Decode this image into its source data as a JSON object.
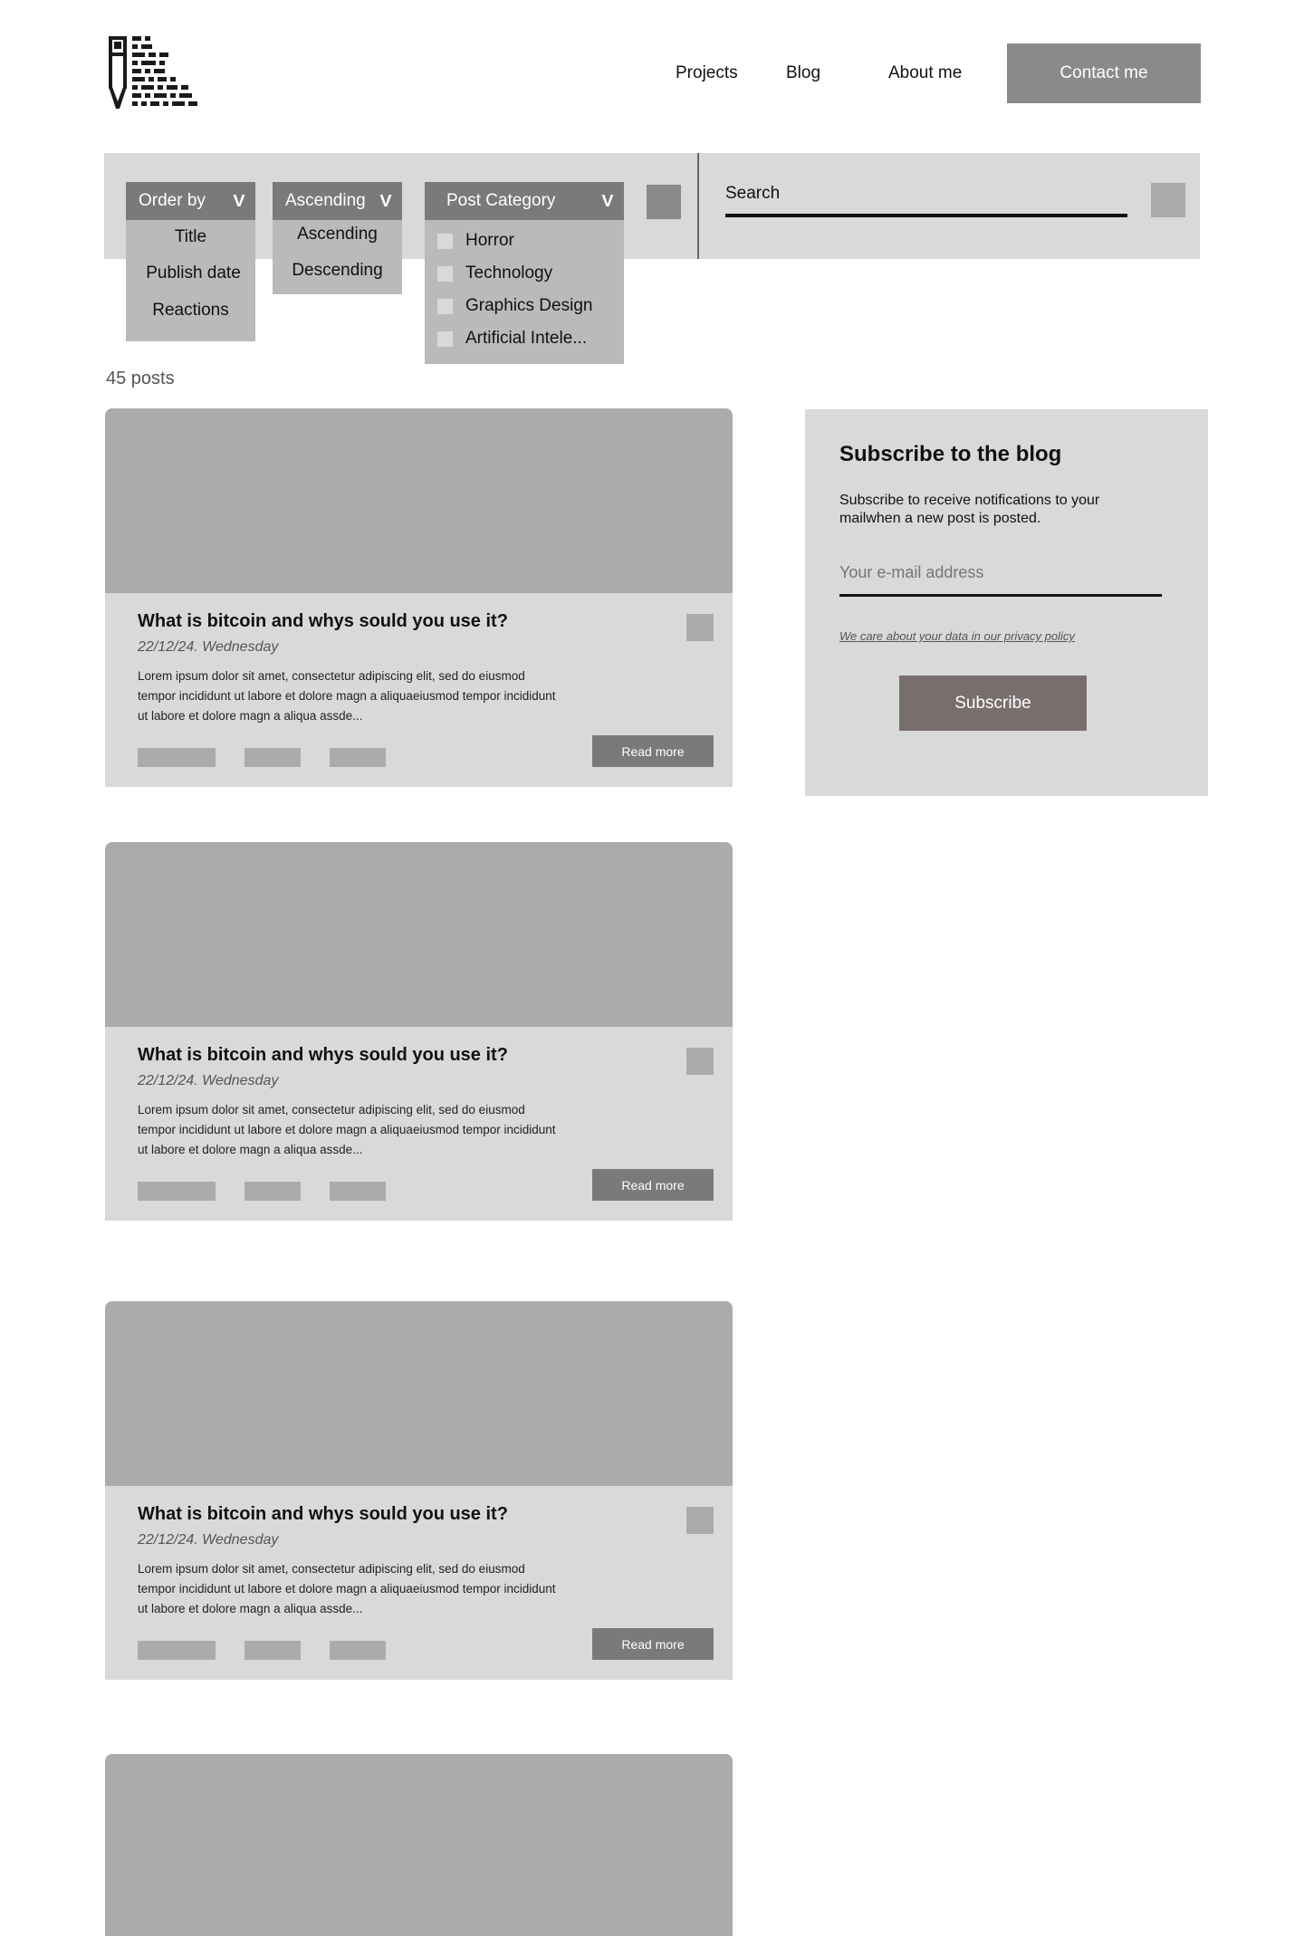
{
  "header": {
    "logo_icon": "pixel-pen-logo",
    "nav": [
      "Projects",
      "Blog",
      "About me"
    ],
    "contact_label": "Contact me"
  },
  "filters": {
    "order_by": {
      "label": "Order by",
      "options": [
        "Title",
        "Publish date",
        "Reactions"
      ]
    },
    "direction": {
      "label": "Ascending",
      "options": [
        "Ascending",
        "Descending"
      ]
    },
    "category": {
      "label": "Post Category",
      "options": [
        "Horror",
        "Technology",
        "Graphics Design",
        "Artificial Intele..."
      ]
    },
    "search_label": "Search"
  },
  "post_count": "45 posts",
  "posts": [
    {
      "title": "What is bitcoin and whys sould you use it?",
      "date": "22/12/24. Wednesday",
      "excerpt": "Lorem ipsum dolor sit amet, consectetur adipiscing elit, sed do eiusmod tempor incididunt ut labore et dolore magn a aliquaeiusmod tempor incididunt ut labore et dolore magn a aliqua assde...",
      "read_more": "Read more"
    },
    {
      "title": "What is bitcoin and whys sould you use it?",
      "date": "22/12/24. Wednesday",
      "excerpt": "Lorem ipsum dolor sit amet, consectetur adipiscing elit, sed do eiusmod tempor incididunt ut labore et dolore magn a aliquaeiusmod tempor incididunt ut labore et dolore magn a aliqua assde...",
      "read_more": "Read more"
    },
    {
      "title": "What is bitcoin and whys sould you use it?",
      "date": "22/12/24. Wednesday",
      "excerpt": "Lorem ipsum dolor sit amet, consectetur adipiscing elit, sed do eiusmod tempor incididunt ut labore et dolore magn a aliquaeiusmod tempor incididunt ut labore et dolore magn a aliqua assde...",
      "read_more": "Read more"
    }
  ],
  "subscribe": {
    "title": "Subscribe to the blog",
    "description": "Subscribe to receive notifications to your mailwhen a new post is posted.",
    "email_placeholder": "Your e-mail address",
    "privacy": "We care about your data in our privacy policy",
    "button": "Subscribe"
  },
  "colors": {
    "panel": "#d9d9d9",
    "placeholder_block": "#ababab",
    "dark_button": "#7a7a7a",
    "subscribe_button": "#786e6e"
  }
}
